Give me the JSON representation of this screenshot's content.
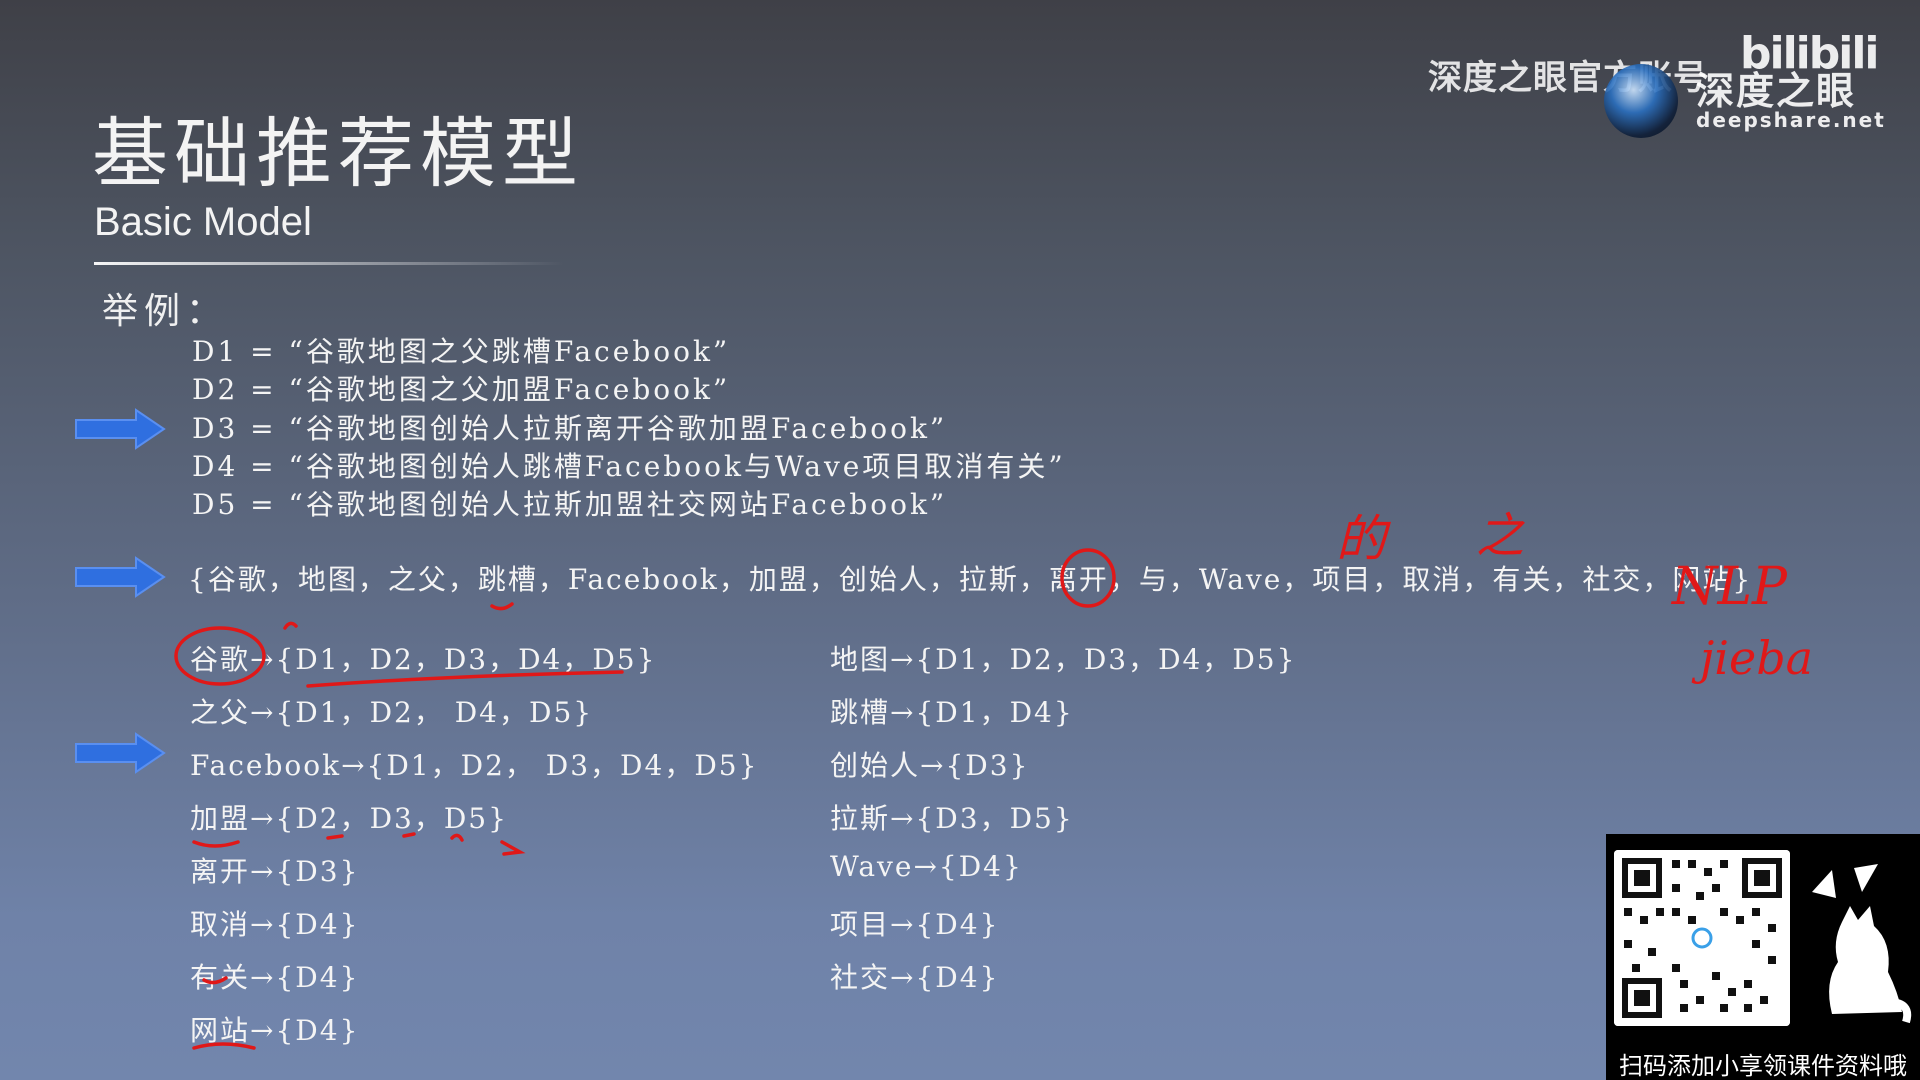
{
  "slide": {
    "title": "基础推荐模型",
    "subtitle": "Basic Model",
    "example_label": "举例："
  },
  "documents": [
    "D1 = “谷歌地图之父跳槽Facebook”",
    "D2 = “谷歌地图之父加盟Facebook”",
    "D3 = “谷歌地图创始人拉斯离开谷歌加盟Facebook”",
    "D4 = “谷歌地图创始人跳槽Facebook与Wave项目取消有关”",
    "D5 = “谷歌地图创始人拉斯加盟社交网站Facebook”"
  ],
  "vocabulary": "{谷歌，地图，之父，跳槽，Facebook，加盟，创始人，拉斯，离开，与，Wave，项目，取消，有关，社交，网站}",
  "inverted_index_left": [
    {
      "term": "谷歌",
      "docs": "{D1，D2，D3，D4，D5}"
    },
    {
      "term": "之父",
      "docs": "{D1，D2，  D4，D5}"
    },
    {
      "term": "Facebook",
      "docs": "{D1，D2，  D3，D4，D5}"
    },
    {
      "term": "加盟",
      "docs": "{D2，D3，D5}"
    },
    {
      "term": "离开",
      "docs": "{D3}"
    },
    {
      "term": "取消",
      "docs": "{D4}"
    },
    {
      "term": "有关",
      "docs": "{D4}"
    },
    {
      "term": "网站",
      "docs": "{D4}"
    }
  ],
  "inverted_index_right": [
    {
      "term": "地图",
      "docs": "{D1，D2，D3，D4，D5}"
    },
    {
      "term": "跳槽",
      "docs": "{D1，D4}"
    },
    {
      "term": "创始人",
      "docs": "{D3}"
    },
    {
      "term": "拉斯",
      "docs": "{D3，D5}"
    },
    {
      "term": "Wave",
      "docs": "{D4}"
    },
    {
      "term": "项目",
      "docs": "{D4}"
    },
    {
      "term": "社交",
      "docs": "{D4}"
    }
  ],
  "arrow_symbol": "→",
  "handwriting": {
    "above_vocab_1": "的",
    "above_vocab_2": "之",
    "side_1": "NLP",
    "side_2": "jieba"
  },
  "watermark": {
    "account": "深度之眼官方账号",
    "logo_cn": "深度之眼",
    "logo_url": "deepshare.net",
    "platform": "bilibili"
  },
  "qr": {
    "caption": "扫码添加小享领课件资料哦"
  },
  "colors": {
    "arrow_blue": "#2f6fe0",
    "annotation_red": "#e01818",
    "text": "#f4f4f4"
  }
}
